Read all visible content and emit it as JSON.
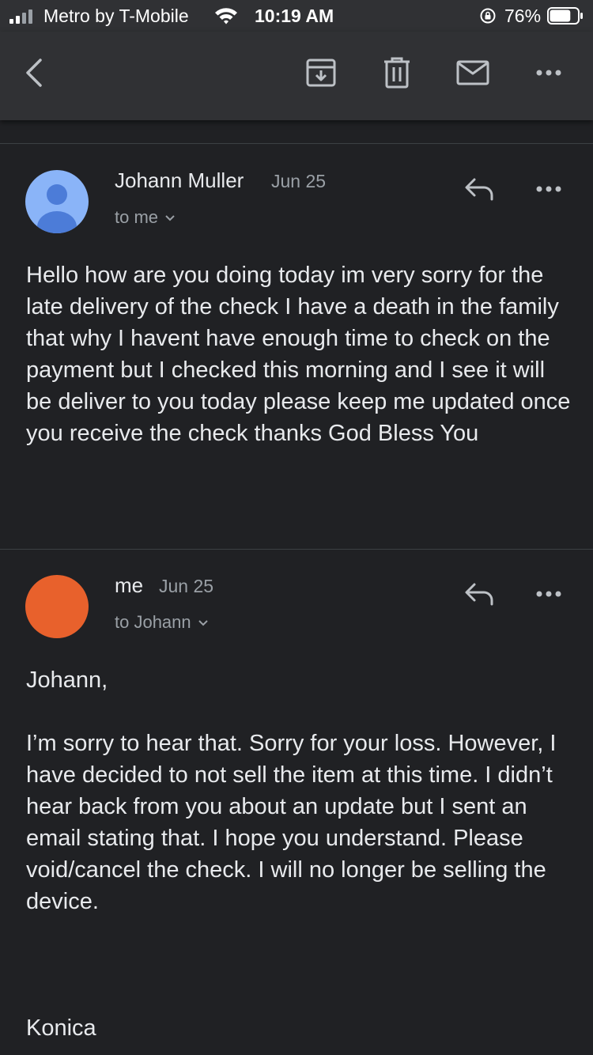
{
  "status_bar": {
    "carrier": "Metro by T-Mobile",
    "time": "10:19 AM",
    "battery_percent": "76%",
    "battery_level": 0.76
  },
  "toolbar": {
    "back_icon": "chevron-left-icon",
    "archive_icon": "archive-icon",
    "delete_icon": "trash-icon",
    "mark_unread_icon": "mail-icon",
    "more_icon": "more-horizontal-icon"
  },
  "messages": [
    {
      "sender": "Johann Muller",
      "date": "Jun 25",
      "recipient": "to me",
      "avatar_color": "#8ab4f8",
      "body": "Hello how are you doing today im very sorry for the late delivery of the check I have a death in the family that why I havent have enough time to check on the payment but I checked this morning and I see it will be deliver to you today please keep me updated once you receive the check thanks God Bless You"
    },
    {
      "sender": "me",
      "date": "Jun 25",
      "recipient": "to Johann",
      "avatar_color": "#e8612c",
      "greeting": "Johann,",
      "body": "I’m sorry to hear that. Sorry for your loss. However, I have decided to not sell the item at this time. I didn’t hear back from you about an update but I sent an email stating that. I hope you understand. Please void/cancel the check. I will no longer be selling the device.",
      "signature": "Konica"
    }
  ]
}
